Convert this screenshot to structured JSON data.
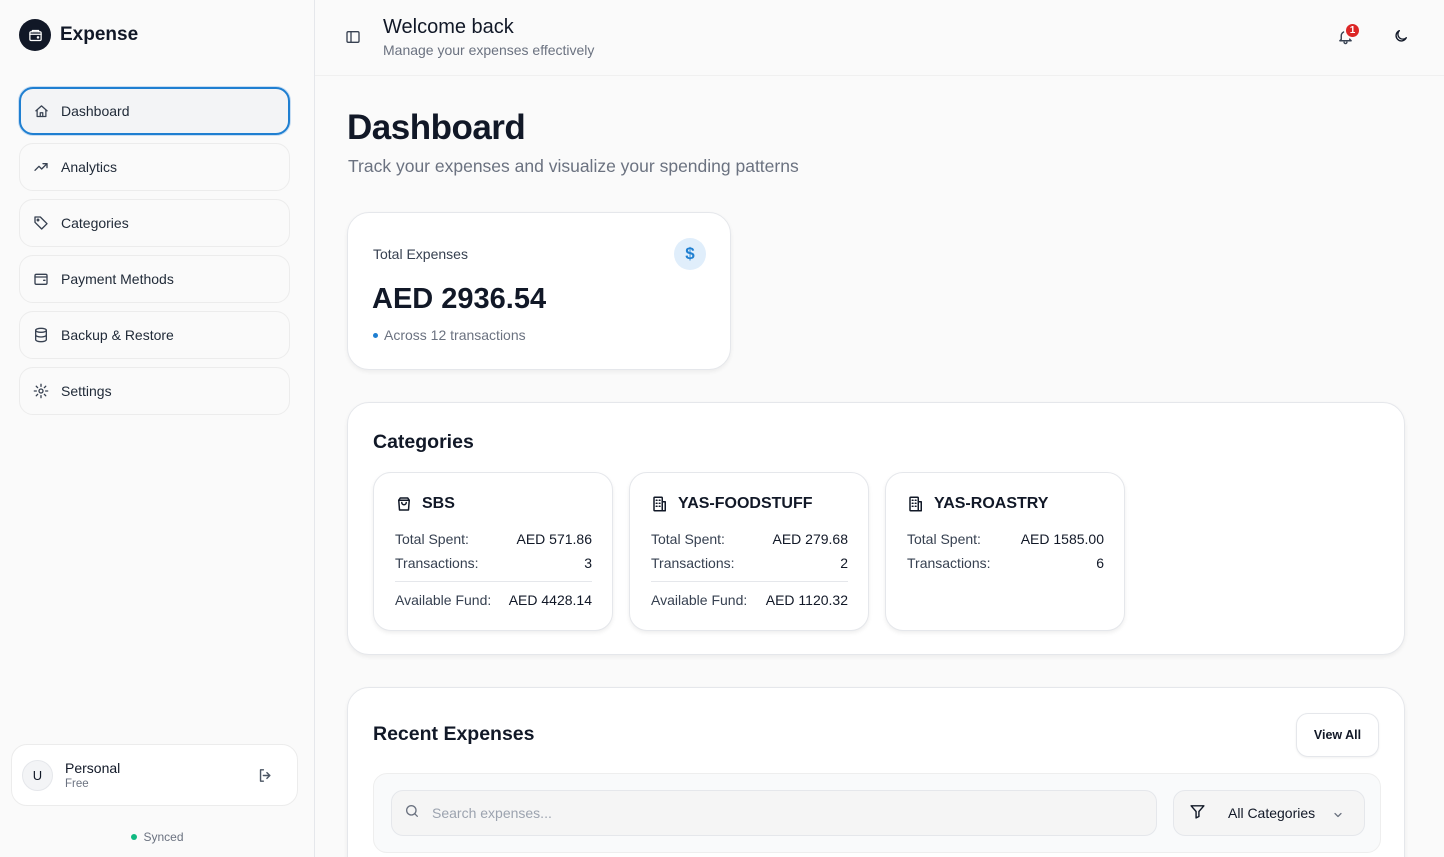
{
  "app": {
    "name": "Expense"
  },
  "sidebar": {
    "items": [
      {
        "label": "Dashboard",
        "icon": "home-icon",
        "active": true
      },
      {
        "label": "Analytics",
        "icon": "trending-up-icon"
      },
      {
        "label": "Categories",
        "icon": "tag-icon"
      },
      {
        "label": "Payment Methods",
        "icon": "wallet-icon"
      },
      {
        "label": "Backup & Restore",
        "icon": "database-icon"
      },
      {
        "label": "Settings",
        "icon": "gear-icon"
      }
    ],
    "user": {
      "initial": "U",
      "name": "Personal",
      "plan": "Free"
    },
    "sync_status": "Synced"
  },
  "header": {
    "title": "Welcome back",
    "subtitle": "Manage your expenses effectively",
    "notification_count": "1"
  },
  "main": {
    "title": "Dashboard",
    "subtitle": "Track your expenses and visualize your spending patterns",
    "total": {
      "label": "Total Expenses",
      "value": "AED 2936.54",
      "meta": "Across 12 transactions",
      "icon": "$"
    },
    "categories": {
      "title": "Categories",
      "items": [
        {
          "name": "SBS",
          "icon": "shopping-bag-icon",
          "total_label": "Total Spent:",
          "total": "AED 571.86",
          "tx_label": "Transactions:",
          "tx": "3",
          "fund_label": "Available Fund:",
          "fund": "AED 4428.14"
        },
        {
          "name": "YAS-FOODSTUFF",
          "icon": "building-icon",
          "total_label": "Total Spent:",
          "total": "AED 279.68",
          "tx_label": "Transactions:",
          "tx": "2",
          "fund_label": "Available Fund:",
          "fund": "AED 1120.32"
        },
        {
          "name": "YAS-ROASTRY",
          "icon": "building-icon",
          "total_label": "Total Spent:",
          "total": "AED 1585.00",
          "tx_label": "Transactions:",
          "tx": "6"
        }
      ]
    },
    "recent": {
      "title": "Recent Expenses",
      "view_all": "View All",
      "search_placeholder": "Search expenses...",
      "category_filter": "All Categories"
    }
  },
  "colors": {
    "accent": "#1f7fd1",
    "badge": "#dc2626",
    "sync": "#10b981"
  }
}
